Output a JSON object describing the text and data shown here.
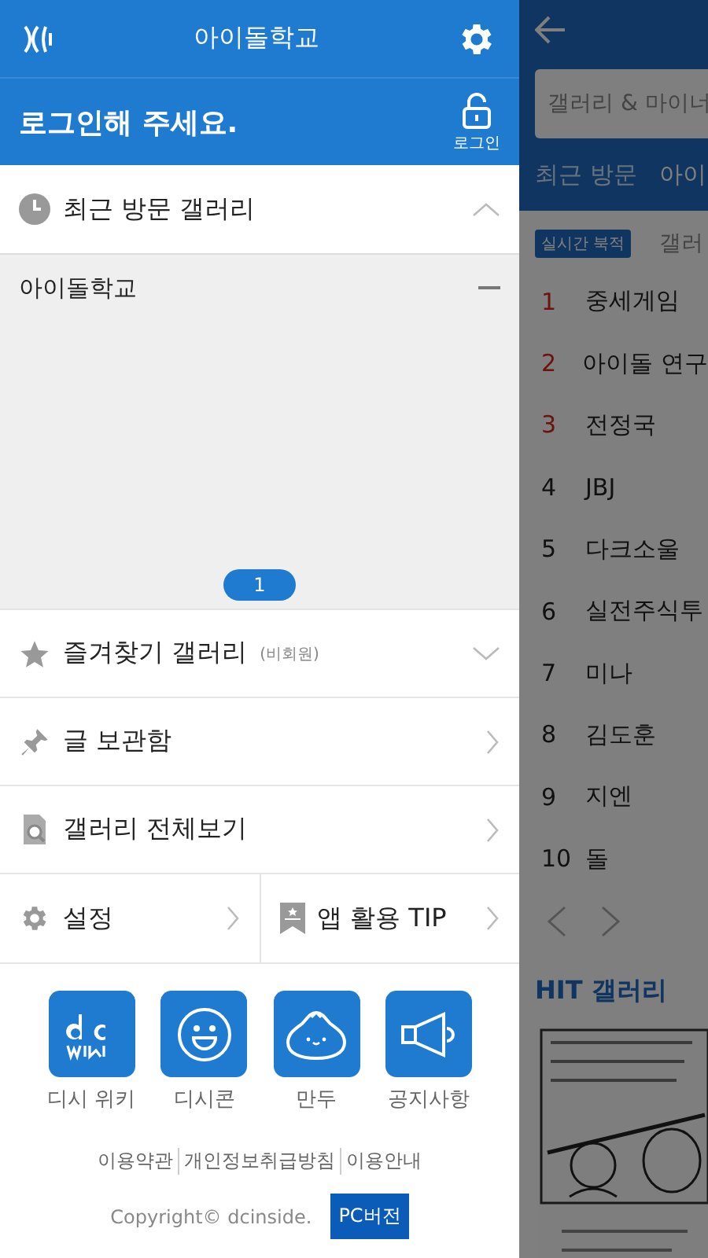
{
  "drawer": {
    "title": "아이돌학교",
    "login": {
      "message": "로그인해 주세요.",
      "button": "로그인"
    },
    "recent": {
      "title": "최근 방문 갤러리",
      "expanded": true,
      "items": [
        {
          "name": "아이돌학교"
        }
      ],
      "page": "1"
    },
    "menu": [
      {
        "kind": "favorites",
        "label": "즐겨찾기 갤러리",
        "note": "(비회원)",
        "expanded": false
      },
      {
        "kind": "saved",
        "label": "글 보관함"
      },
      {
        "kind": "browse",
        "label": "갤러리 전체보기"
      }
    ],
    "pair": [
      {
        "kind": "settings",
        "label": "설정"
      },
      {
        "kind": "tip",
        "label": "앱 활용 TIP"
      }
    ],
    "shortcuts": [
      {
        "kind": "wiki",
        "label": "디시 위키"
      },
      {
        "kind": "smile",
        "label": "디시콘"
      },
      {
        "kind": "dumpling",
        "label": "만두"
      },
      {
        "kind": "megaphone",
        "label": "공지사항"
      }
    ],
    "links": [
      "이용약관",
      "개인정보취급방침",
      "이용안내"
    ],
    "copyright": "Copyright© dcinside.",
    "pc_button": "PC버전"
  },
  "page": {
    "search": {
      "placeholder": "갤러리 & 마이너"
    },
    "tabs": [
      {
        "label": "최근 방문",
        "selected": false
      },
      {
        "label": "아이",
        "selected": true
      }
    ],
    "realtime_badge": "실시간 북적",
    "section_tab": "갤러",
    "ranks": [
      {
        "rank": "1",
        "name": "중세게임",
        "hot": true
      },
      {
        "rank": "2",
        "name": "아이돌 연구",
        "hot": true
      },
      {
        "rank": "3",
        "name": "전정국",
        "hot": true
      },
      {
        "rank": "4",
        "name": "JBJ",
        "hot": false
      },
      {
        "rank": "5",
        "name": "다크소울",
        "hot": false
      },
      {
        "rank": "6",
        "name": "실전주식투",
        "hot": false
      },
      {
        "rank": "7",
        "name": "미나",
        "hot": false
      },
      {
        "rank": "8",
        "name": "김도훈",
        "hot": false
      },
      {
        "rank": "9",
        "name": "지엔",
        "hot": false
      },
      {
        "rank": "10",
        "name": "돌",
        "hot": false
      }
    ],
    "hit_title": "HIT 갤러리"
  }
}
